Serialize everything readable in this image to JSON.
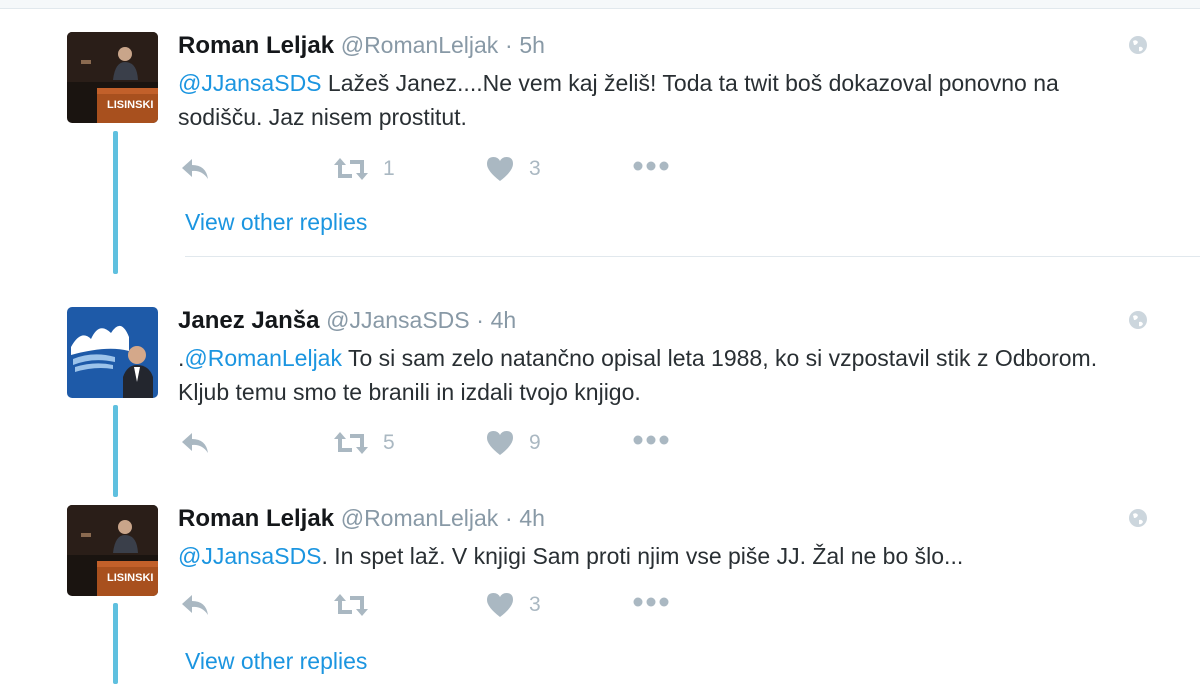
{
  "tweets": [
    {
      "name": "Roman Leljak",
      "handle": "@RomanLeljak",
      "dot": "·",
      "time": "5h",
      "mention": "@JJansaSDS",
      "text": " Lažeš Janez....Ne vem kaj želiš! Toda  ta twit boš dokazoval ponovno na sodišču. Jaz nisem prostitut.",
      "retweets": "1",
      "likes": "3",
      "avatar_text": "LISINSKI"
    },
    {
      "name": "Janez Janša",
      "handle": "@JJansaSDS",
      "dot": "·",
      "time": "4h",
      "prefix": ".",
      "mention": "@RomanLeljak",
      "text": " To si sam zelo natančno opisal leta 1988, ko si vzpostavil stik z Odborom. Kljub temu smo te branili in izdali tvojo knjigo.",
      "retweets": "5",
      "likes": "9"
    },
    {
      "name": "Roman Leljak",
      "handle": "@RomanLeljak",
      "dot": "·",
      "time": "4h",
      "mention": "@JJansaSDS",
      "text": ". In spet laž. V knjigi Sam proti njim vse piše JJ. Žal ne bo šlo...",
      "retweets": "",
      "likes": "3",
      "avatar_text": "LISINSKI"
    }
  ],
  "view_other_replies": "View other replies",
  "colors": {
    "link": "#1b95e0",
    "thread": "#5fc0df",
    "icon": "#aab8c2"
  }
}
